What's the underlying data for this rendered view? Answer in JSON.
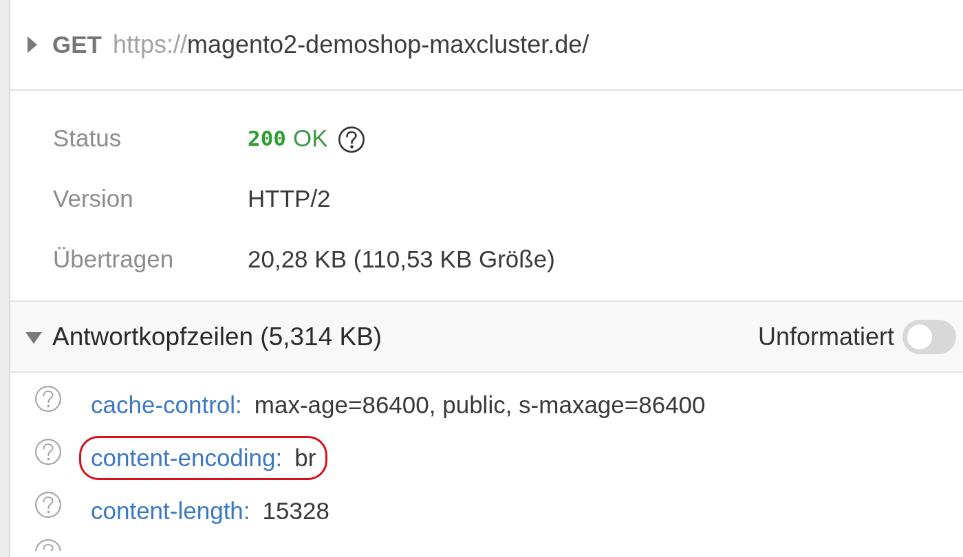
{
  "request": {
    "expanded": false,
    "method": "GET",
    "url": {
      "scheme": "https://",
      "address": "magento2-demoshop-maxcluster.de/"
    }
  },
  "summary": [
    {
      "kind": "status",
      "label": "Status",
      "code": "200",
      "text": "OK"
    },
    {
      "kind": "plain",
      "label": "Version",
      "value": "HTTP/2"
    },
    {
      "kind": "plain",
      "label": "Übertragen",
      "value": "20,28 KB (110,53 KB Größe)"
    }
  ],
  "response_headers": {
    "expanded": true,
    "title": "Antwortkopfzeilen (5,314 KB)",
    "raw_toggle": {
      "label": "Unformatiert",
      "on": false
    },
    "rows": [
      {
        "name": "cache-control:",
        "value": "max-age=86400, public, s-maxage=86400",
        "highlighted": false
      },
      {
        "name": "content-encoding:",
        "value": "br",
        "highlighted": true
      },
      {
        "name": "content-length:",
        "value": "15328",
        "highlighted": false
      }
    ],
    "more_below": true
  }
}
